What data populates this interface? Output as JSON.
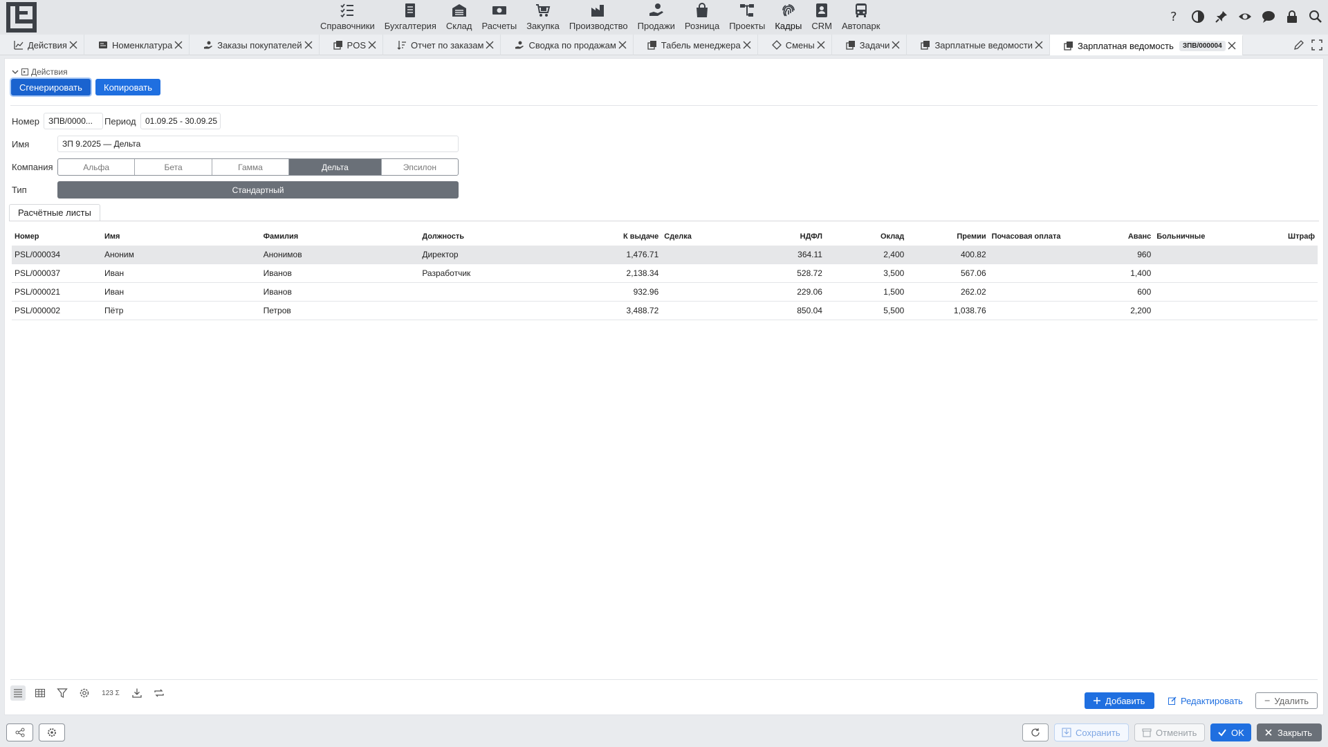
{
  "colors": {
    "accent": "#1f6fe0",
    "selected_segment": "#6a7078",
    "close_button": "#6a7078"
  },
  "menu": [
    {
      "label": "Справочники",
      "icon": "checklist-icon"
    },
    {
      "label": "Бухгалтерия",
      "icon": "ledger-icon"
    },
    {
      "label": "Склад",
      "icon": "warehouse-icon"
    },
    {
      "label": "Расчеты",
      "icon": "money-icon"
    },
    {
      "label": "Закупка",
      "icon": "cart-icon"
    },
    {
      "label": "Производство",
      "icon": "factory-icon"
    },
    {
      "label": "Продажи",
      "icon": "hand-money-icon"
    },
    {
      "label": "Розница",
      "icon": "shopping-bag-icon"
    },
    {
      "label": "Проекты",
      "icon": "project-tree-icon"
    },
    {
      "label": "Кадры",
      "icon": "fingerprint-icon"
    },
    {
      "label": "CRM",
      "icon": "contact-card-icon"
    },
    {
      "label": "Автопарк",
      "icon": "bus-icon"
    }
  ],
  "tabs": [
    {
      "label": "Действия",
      "icon": "chart-line-icon"
    },
    {
      "label": "Номенклатура",
      "icon": "catalog-icon"
    },
    {
      "label": "Заказы покупателей",
      "icon": "hand-money-icon"
    },
    {
      "label": "POS",
      "icon": "copy-doc-icon"
    },
    {
      "label": "Отчет по заказам",
      "icon": "sort-icon"
    },
    {
      "label": "Сводка по продажам",
      "icon": "hand-money-icon"
    },
    {
      "label": "Табель менеджера",
      "icon": "copy-doc-icon"
    },
    {
      "label": "Смены",
      "icon": "diamond-icon"
    },
    {
      "label": "Задачи",
      "icon": "copy-doc-icon"
    },
    {
      "label": "Зарплатные ведомости",
      "icon": "copy-doc-icon"
    },
    {
      "label": "Зарплатная ведомость",
      "icon": "copy-doc-icon",
      "badge": "ЗПВ/000004",
      "active": true
    }
  ],
  "actions": {
    "header": "Действия",
    "generate": "Сгенерировать",
    "copy": "Копировать"
  },
  "form": {
    "number_label": "Номер",
    "number_value": "ЗПВ/0000...",
    "period_label": "Период",
    "period_value": "01.09.25 - 30.09.25",
    "name_label": "Имя",
    "name_value": "ЗП 9.2025 — Дельта",
    "company_label": "Компания",
    "companies": [
      "Альфа",
      "Бета",
      "Гамма",
      "Дельта",
      "Эпсилон"
    ],
    "company_selected": "Дельта",
    "type_label": "Тип",
    "type_value": "Стандартный"
  },
  "subtab": "Расчётные листы",
  "table": {
    "headers": [
      "Номер",
      "Имя",
      "Фамилия",
      "Должность",
      "К выдаче",
      "Сделка",
      "НДФЛ",
      "Оклад",
      "Премии",
      "Почасовая оплата",
      "Аванс",
      "Больничные",
      "Штраф"
    ],
    "rows": [
      [
        "PSL/000034",
        "Аноним",
        "Анонимов",
        "Директор",
        "1,476.71",
        "",
        "364.11",
        "2,400",
        "400.82",
        "",
        "960",
        "",
        ""
      ],
      [
        "PSL/000037",
        "Иван",
        "Иванов",
        "Разработчик",
        "2,138.34",
        "",
        "528.72",
        "3,500",
        "567.06",
        "",
        "1,400",
        "",
        ""
      ],
      [
        "PSL/000021",
        "Иван",
        "Иванов",
        "",
        "932.96",
        "",
        "229.06",
        "1,500",
        "262.02",
        "",
        "600",
        "",
        ""
      ],
      [
        "PSL/000002",
        "Пётр",
        "Петров",
        "",
        "3,488.72",
        "",
        "850.04",
        "5,500",
        "1,038.76",
        "",
        "2,200",
        "",
        ""
      ]
    ]
  },
  "bottom": {
    "sum_label": "123 Σ",
    "add": "Добавить",
    "edit": "Редактировать",
    "delete": "Удалить"
  },
  "status": {
    "save": "Сохранить",
    "cancel": "Отменить",
    "ok": "OK",
    "close": "Закрыть"
  }
}
